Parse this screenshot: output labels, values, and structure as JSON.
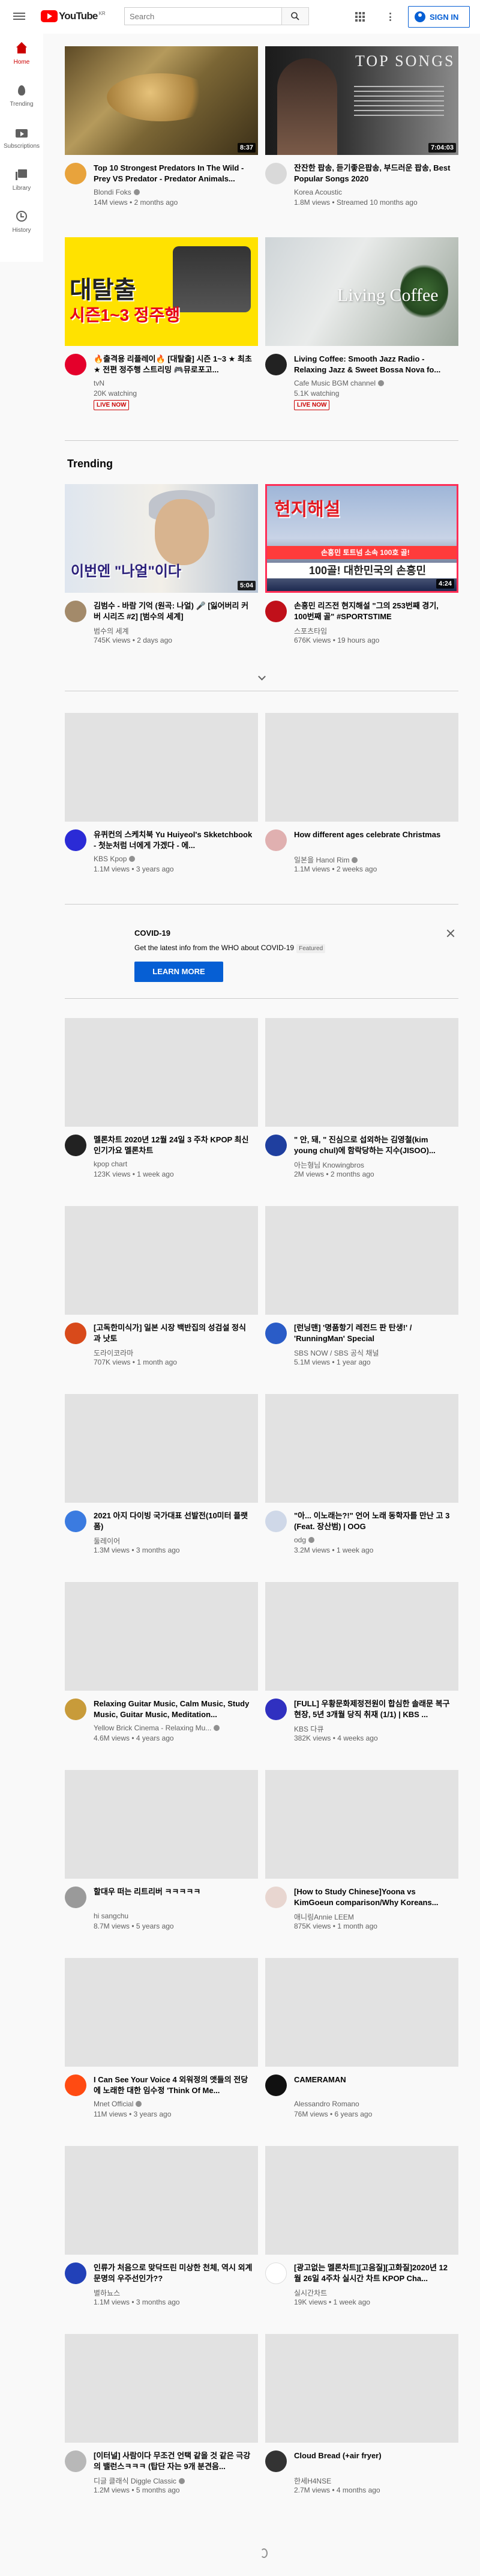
{
  "header": {
    "logo_text": "YouTube",
    "logo_region": "KR",
    "search_placeholder": "Search",
    "signin_label": "SIGN IN"
  },
  "guide": {
    "items": [
      {
        "label": "Home",
        "icon": "home-icon",
        "active": true
      },
      {
        "label": "Trending",
        "icon": "trending-icon"
      },
      {
        "label": "Subscriptions",
        "icon": "subscriptions-icon"
      },
      {
        "label": "Library",
        "icon": "library-icon"
      },
      {
        "label": "History",
        "icon": "history-icon"
      }
    ]
  },
  "videos": [
    {
      "title": "Top 10 Strongest Predators In The Wild - Prey VS Predator - Predator Animals...",
      "channel": "Blondi Foks",
      "verified": true,
      "meta": "14M views • 2 months ago",
      "duration": "8:37",
      "avatar_color": "#e8a33c"
    },
    {
      "title": "잔잔한 팝송, 듣기좋은팝송, 부드러운 팝송, Best Popular Songs 2020",
      "channel": "Korea Acoustic",
      "meta": "1.8M views • Streamed 10 months ago",
      "duration": "7:04:03",
      "avatar_color": "#d9d9d9"
    },
    {
      "title": "🔥출격용 리플레이🔥 [대탈출] 시즌 1~3 ★ 최초★ 전편 정주행 스트리밍 🎮뮤로포고...",
      "channel": "tvN",
      "meta": "20K watching",
      "live_label": "LIVE NOW",
      "avatar_color": "#e4002b"
    },
    {
      "title": "Living Coffee: Smooth Jazz Radio - Relaxing Jazz & Sweet Bossa Nova fo...",
      "channel": "Cafe Music BGM channel",
      "verified": true,
      "meta": "5.1K watching",
      "live_label": "LIVE NOW",
      "avatar_color": "#222222"
    }
  ],
  "trending": {
    "title": "Trending",
    "videos": [
      {
        "title": "김범수 - 바람 기억 (원곡: 나얼) 🎤 [잃어버리 커버 시리즈 #2] [범수의 세계]",
        "channel": "범수의 세계",
        "meta": "745K views • 2 days ago",
        "duration": "5:04",
        "thumb_text": "이번엔 \"나얼\"이다",
        "avatar_color": "#a38a6a"
      },
      {
        "title": "손흥민 리즈전 현지해설 \"그의 253번째 경기, 100번째 골\" #SPORTSTIME",
        "channel": "스포츠타임",
        "meta": "676K views • 19 hours ago",
        "duration": "4:24",
        "thumb_text": "100골! 대한민국의 손흥민",
        "thumb_top": "현지해설",
        "thumb_strip": "손흥민 토트넘 소속 100호 골!",
        "avatar_color": "#c0101a"
      }
    ]
  },
  "videos2": [
    {
      "title": "유퀴컨의 스케치북 Yu Huiyeol's Skketchbook - 첫눈처럼 너에게 가겠다 - 에...",
      "channel": "KBS Kpop",
      "verified": true,
      "meta": "1.1M views • 3 years ago",
      "avatar_color": "#2b2bd6"
    },
    {
      "title": "How different ages celebrate Christmas",
      "channel": "일본을 Hanol Rim",
      "verified": true,
      "meta": "1.1M views • 2 weeks ago",
      "avatar_color": "#e0b0b0"
    }
  ],
  "covid": {
    "title": "COVID-19",
    "text": "Get the latest info from the WHO about COVID-19",
    "featured_label": "Featured",
    "button_label": "LEARN MORE"
  },
  "grid": [
    {
      "title": "멜론차트 2020년 12월 24일 3 주차 KPOP 최신 인기가요 멜론차트",
      "channel": "kpop chart",
      "meta": "123K views • 1 week ago",
      "avatar_color": "#222222"
    },
    {
      "title": "\" 안, 돼, \" 진심으로 섭외하는 김영철(kim young chul)에 함락당하는 지수(JISOO)...",
      "channel": "아는형님 Knowingbros",
      "meta": "2M views • 2 months ago",
      "avatar_color": "#1f3f9f"
    },
    {
      "title": "[고독한미식가] 일본 시장 백반집의 성검설 정식과 낫토",
      "channel": "도라이코라마",
      "meta": "707K views • 1 month ago",
      "avatar_color": "#d84a1b"
    },
    {
      "title": "[런닝맨] '명품항기 레전드 판 탄생!' / 'RunningMan' Special",
      "channel": "SBS NOW / SBS 공식 채널",
      "meta": "5.1M views • 1 year ago",
      "avatar_color": "#2a5cc7"
    },
    {
      "title": "2021 아지 다이빙 국가대표 선발전(10미터 플랫폼)",
      "channel": "둘레이어",
      "meta": "1.3M views • 3 months ago",
      "avatar_color": "#3b7be0"
    },
    {
      "title": "\"아... 이노래는?!\" 언어 노래 동학자를 만난 고 3 (Feat. 장산범) | OOG",
      "channel": "odg",
      "verified": true,
      "meta": "3.2M views • 1 week ago",
      "avatar_color": "#cfd8e8"
    },
    {
      "title": "Relaxing Guitar Music, Calm Music, Study Music, Guitar Music, Meditation...",
      "channel": "Yellow Brick Cinema - Relaxing Mu...",
      "verified": true,
      "meta": "4.6M views • 4 years ago",
      "avatar_color": "#c89b3a"
    },
    {
      "title": "[FULL] 우황문화제정전원이 합심한 솔래문 복구 현장, 5년 3개월 당직 취재 (1/1) | KBS ...",
      "channel": "KBS 다큐",
      "meta": "382K views • 4 weeks ago",
      "avatar_color": "#3030c0"
    },
    {
      "title": "할대우 떠는 리트리버 ㅋㅋㅋㅋㅋ",
      "channel": "hi sangchu",
      "meta": "8.7M views • 5 years ago",
      "avatar_color": "#9a9a9a"
    },
    {
      "title": "[How to Study Chinese]Yoona vs KimGoeun comparison/Why Koreans...",
      "channel": "애니링Annie LEEM",
      "meta": "875K views • 1 month ago",
      "avatar_color": "#e8d6d0"
    },
    {
      "title": "I Can See Your Voice 4 외워정의 앳들의 전당에 노래한 대한 임수정 'Think Of Me...",
      "channel": "Mnet Official",
      "verified": true,
      "meta": "11M views • 3 years ago",
      "avatar_color": "#ff4b12"
    },
    {
      "title": "CAMERAMAN",
      "channel": "Alessandro Romano",
      "meta": "76M views • 6 years ago",
      "avatar_color": "#111111"
    },
    {
      "title": "인류가 처음으로 맞닥뜨린 미상한 천체, 역시 외계 문명의 우주선인가??",
      "channel": "별하뇨스",
      "meta": "1.1M views • 3 months ago",
      "avatar_color": "#2241b8"
    },
    {
      "title": "[광고없는 멜론차트][고음질][고화질]2020년 12월 26일 4주차 실시간 차트 KPOP Cha...",
      "channel": "실시간차트",
      "meta": "19K views • 1 week ago",
      "avatar_color": "#ffffff"
    },
    {
      "title": "[이터널] 사람이다 무조건 언택 같을 것 같은 극강의 밸런스ㅋㅋㅋ (탑단 자는 9개 분견음...",
      "channel": "디글 클래식 Diggle Classic",
      "verified": true,
      "meta": "1.2M views • 5 months ago",
      "avatar_color": "#b8b8b8"
    },
    {
      "title": "Cloud Bread (+air fryer)",
      "channel": "한세H4NSE",
      "meta": "2.7M views • 4 months ago",
      "avatar_color": "#333333"
    }
  ]
}
